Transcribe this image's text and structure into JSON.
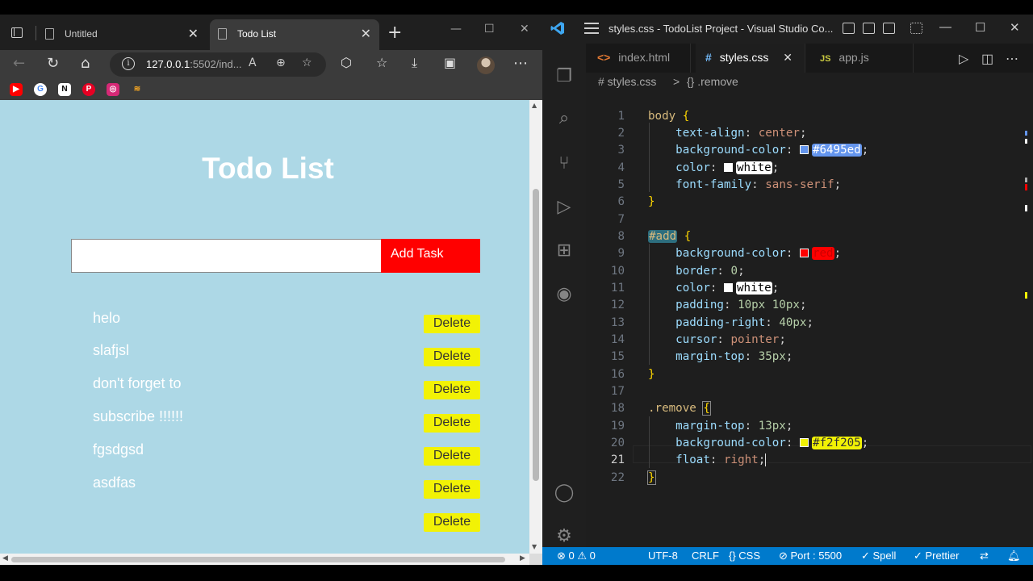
{
  "browser": {
    "tabs": [
      {
        "label": "Untitled",
        "close": "✕",
        "active": false
      },
      {
        "label": "Todo List",
        "close": "✕",
        "active": true
      }
    ],
    "new_tab": "+",
    "address": {
      "host": "127.0.0.1",
      "rest": ":5502/ind..."
    },
    "bookmarks": [
      "youtube-icon",
      "google-icon",
      "notion-icon",
      "pinterest-icon",
      "instagram-icon",
      "bookmark-icon"
    ]
  },
  "todo": {
    "title": "Todo List",
    "input_value": "",
    "add_label": "Add Task",
    "items": [
      "helo",
      "slafjsl",
      "don't forget to",
      "subscribe !!!!!!",
      "fgsdgsd",
      "asdfas"
    ],
    "delete_label": "Delete",
    "colors": {
      "background": "#add8e6",
      "add_button": "#ff0000",
      "delete_button": "#f2f205"
    }
  },
  "vscode": {
    "window_title": "styles.css - TodoList Project - Visual Studio Co...",
    "tabs": [
      {
        "icon": "<>",
        "label": "index.html",
        "active": false
      },
      {
        "icon": "#",
        "label": "styles.css",
        "active": true,
        "close": "✕"
      },
      {
        "icon": "JS",
        "label": "app.js",
        "active": false
      }
    ],
    "breadcrumb": {
      "file": "# styles.css",
      "sep": ">",
      "symbol": "{} .remove"
    },
    "line_numbers": [
      "1",
      "2",
      "3",
      "4",
      "5",
      "6",
      "7",
      "8",
      "9",
      "10",
      "11",
      "12",
      "13",
      "14",
      "15",
      "16",
      "17",
      "18",
      "19",
      "20",
      "21",
      "22"
    ],
    "current_line": 21,
    "code": {
      "l1": {
        "sel": "body",
        "brace": "{"
      },
      "l2": {
        "prop": "text-align",
        "val": "center"
      },
      "l3": {
        "prop": "background-color",
        "val": "#6495ed",
        "swatch": "#6495ed"
      },
      "l4": {
        "prop": "color",
        "val": "white",
        "swatch": "#ffffff"
      },
      "l5": {
        "prop": "font-family",
        "val": "sans-serif"
      },
      "l6": {
        "brace": "}"
      },
      "l8": {
        "sel": "#add",
        "brace": "{"
      },
      "l9": {
        "prop": "background-color",
        "val": "red",
        "swatch": "#ff0000"
      },
      "l10": {
        "prop": "border",
        "val": "0"
      },
      "l11": {
        "prop": "color",
        "val": "white",
        "swatch": "#ffffff"
      },
      "l12": {
        "prop": "padding",
        "val": "10px 10px"
      },
      "l13": {
        "prop": "padding-right",
        "val": "40px"
      },
      "l14": {
        "prop": "cursor",
        "val": "pointer"
      },
      "l15": {
        "prop": "margin-top",
        "val": "35px"
      },
      "l16": {
        "brace": "}"
      },
      "l18": {
        "sel": ".remove",
        "brace": "{"
      },
      "l19": {
        "prop": "margin-top",
        "val": "13px"
      },
      "l20": {
        "prop": "background-color",
        "val": "#f2f205",
        "swatch": "#f2f205"
      },
      "l21": {
        "prop": "float",
        "val": "right"
      },
      "l22": {
        "brace": "}"
      }
    },
    "status": {
      "errors": "0",
      "warnings": "0",
      "encoding": "UTF-8",
      "eol": "CRLF",
      "language": "CSS",
      "port": "Port : 5500",
      "spell": "Spell",
      "prettier": "Prettier"
    }
  }
}
